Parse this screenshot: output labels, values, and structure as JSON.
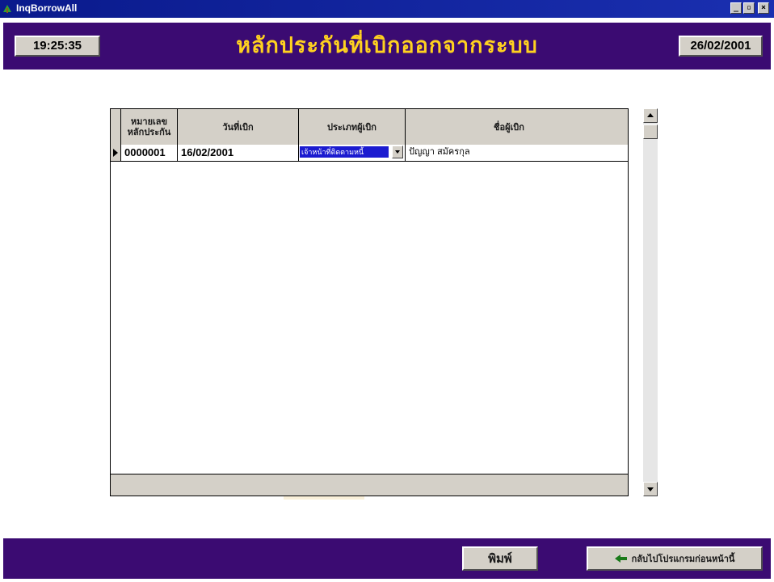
{
  "window": {
    "title": "InqBorrowAll",
    "controls": [
      "minimize-icon",
      "maximize-icon",
      "close-icon"
    ]
  },
  "header": {
    "time": "19:25:35",
    "title": "หลักประกันที่เบิกออกจากระบบ",
    "date": "26/02/2001"
  },
  "grid": {
    "columns": [
      {
        "label": "หมายเลข\nหลักประกัน"
      },
      {
        "label": "วันที่เบิก"
      },
      {
        "label": "ประเภทผู้เบิก"
      },
      {
        "label": "ชื่อผู้เบิก"
      }
    ],
    "rows": [
      {
        "collateral_no": "0000001",
        "withdraw_date": "16/02/2001",
        "withdrawer_type": "เจ้าหน้าที่ติดตามหนี้",
        "withdrawer_name": "ปัญญา  สมัครกุล"
      }
    ]
  },
  "footer": {
    "print_label": "พิมพ์",
    "back_label": "กลับไปโปรแกรมก่อนหน้านี้"
  },
  "colors": {
    "titlebar": "#0a1a8c",
    "header_bg": "#3b0b72",
    "title_text": "#ffd21f",
    "selection": "#1b1bd0",
    "button_face": "#d4d0c8"
  }
}
